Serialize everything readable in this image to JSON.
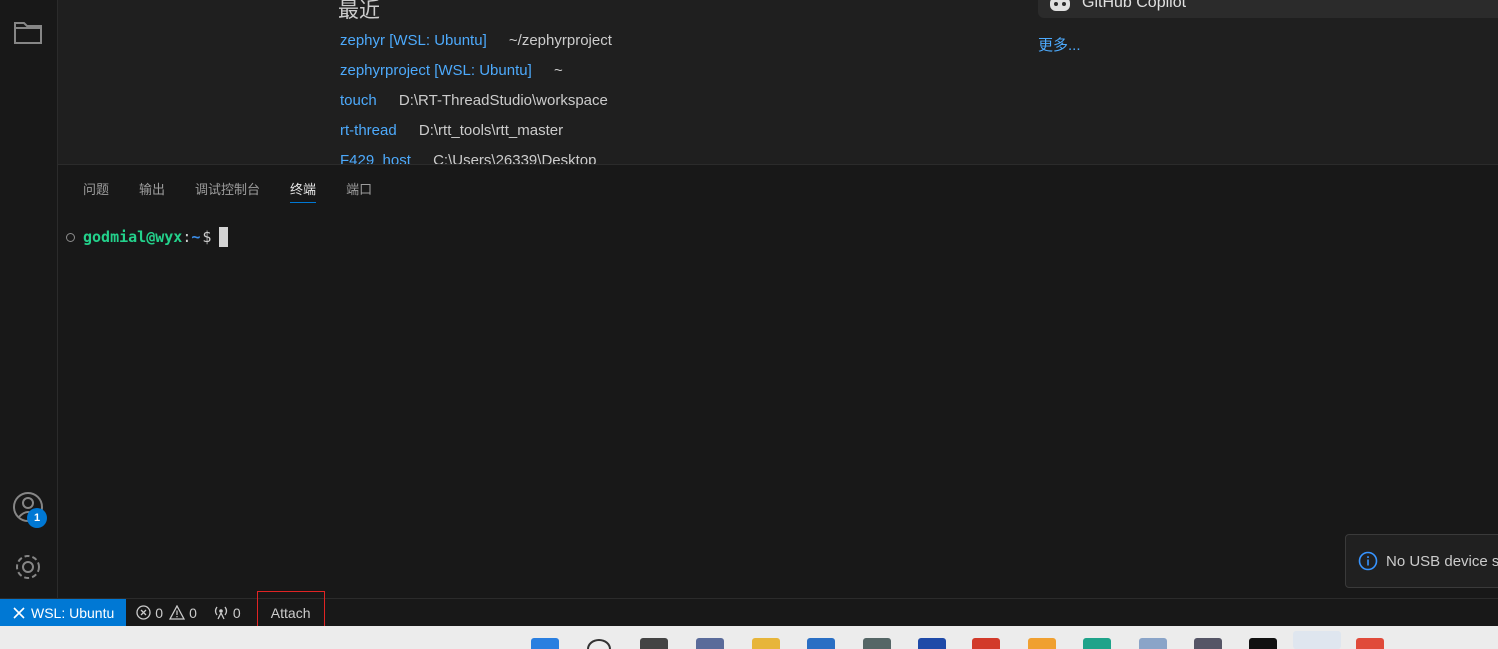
{
  "colors": {
    "accent": "#0078d4",
    "link": "#4daafc",
    "prompt_user": "#23d18b",
    "prompt_path": "#3b8eea",
    "highlight_box": "#e02424"
  },
  "activity_bar": {
    "icons": [
      "files-icon",
      "accounts-icon",
      "gear-icon"
    ],
    "accounts_badge": "1"
  },
  "welcome": {
    "recent_title": "最近",
    "recent": [
      {
        "name": "zephyr [WSL: Ubuntu]",
        "path": "~/zephyrproject"
      },
      {
        "name": "zephyrproject [WSL: Ubuntu]",
        "path": "~"
      },
      {
        "name": "touch",
        "path": "D:\\RT-ThreadStudio\\workspace"
      },
      {
        "name": "rt-thread",
        "path": "D:\\rtt_tools\\rtt_master"
      },
      {
        "name": "F429_host",
        "path": "C:\\Users\\26339\\Desktop"
      }
    ],
    "copilot_label": "GitHub Copilot",
    "more_link": "更多..."
  },
  "panel": {
    "tabs": [
      {
        "label": "问题",
        "active": false
      },
      {
        "label": "输出",
        "active": false
      },
      {
        "label": "调试控制台",
        "active": false
      },
      {
        "label": "终端",
        "active": true
      },
      {
        "label": "端口",
        "active": false
      }
    ],
    "terminal": {
      "user_host": "godmial@wyx",
      "colon": ":",
      "path": "~",
      "dollar": "$"
    }
  },
  "notification": {
    "icon": "info-icon",
    "text": "No USB device s"
  },
  "status_bar": {
    "remote_label": "WSL: Ubuntu",
    "errors": "0",
    "warnings": "0",
    "ports": "0",
    "attach_label": "Attach"
  }
}
